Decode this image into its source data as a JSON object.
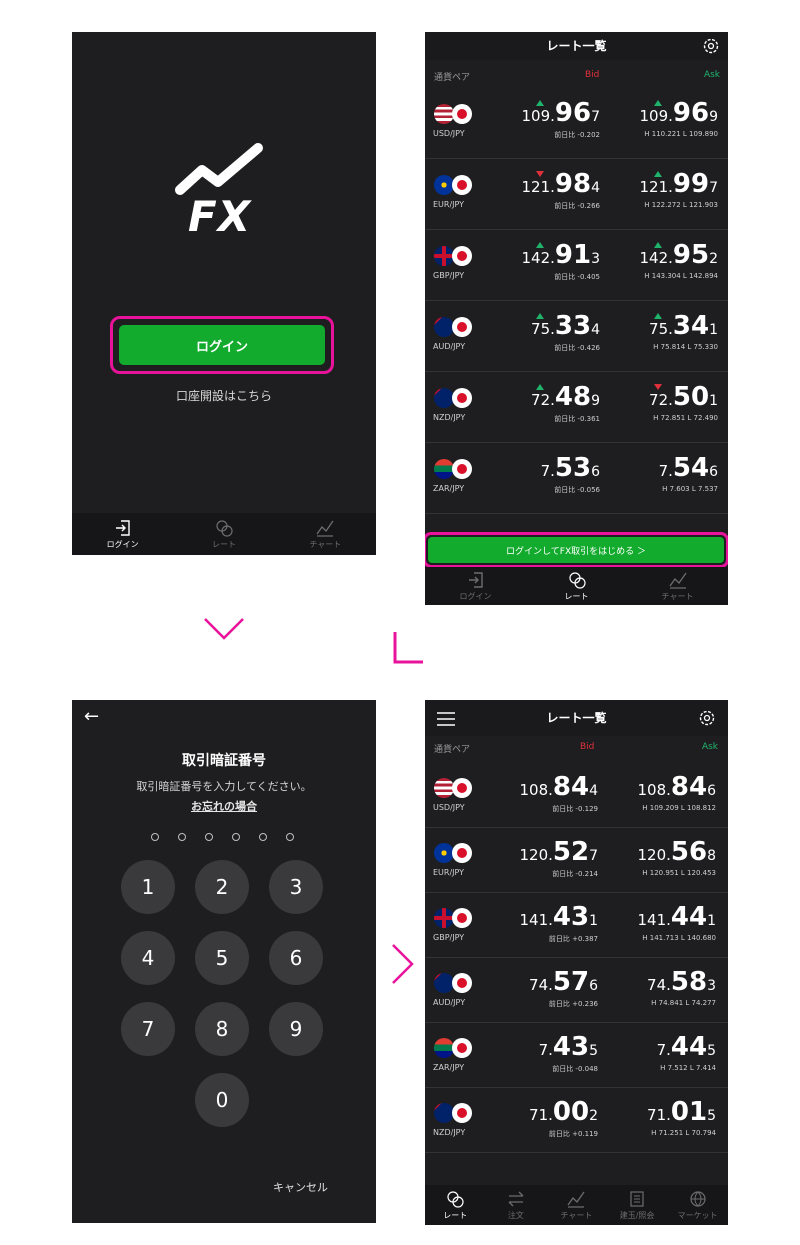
{
  "login": {
    "logo_text": "FX",
    "login_button": "ログイン",
    "open_account": "口座開設はこちら",
    "tabs": [
      {
        "label": "ログイン",
        "icon": "login-icon",
        "active": true
      },
      {
        "label": "レート",
        "icon": "rate-icon",
        "active": false
      },
      {
        "label": "チャート",
        "icon": "chart-icon",
        "active": false
      }
    ]
  },
  "rates1": {
    "title": "レート一覧",
    "col_pair": "通貨ペア",
    "col_bid": "Bid",
    "col_ask": "Ask",
    "rows": [
      {
        "pair": "USD/JPY",
        "bid": {
          "a": "109.",
          "b": "96",
          "c": "7",
          "dir": "up"
        },
        "ask": {
          "a": "109.",
          "b": "96",
          "c": "9",
          "dir": "up"
        },
        "change": "前日比 -0.202",
        "hl": "H 110.221   L 109.890"
      },
      {
        "pair": "EUR/JPY",
        "bid": {
          "a": "121.",
          "b": "98",
          "c": "4",
          "dir": "dn"
        },
        "ask": {
          "a": "121.",
          "b": "99",
          "c": "7",
          "dir": "up"
        },
        "change": "前日比 -0.266",
        "hl": "H 122.272   L 121.903"
      },
      {
        "pair": "GBP/JPY",
        "bid": {
          "a": "142.",
          "b": "91",
          "c": "3",
          "dir": "up"
        },
        "ask": {
          "a": "142.",
          "b": "95",
          "c": "2",
          "dir": "up"
        },
        "change": "前日比 -0.405",
        "hl": "H 143.304   L 142.894"
      },
      {
        "pair": "AUD/JPY",
        "bid": {
          "a": "75.",
          "b": "33",
          "c": "4",
          "dir": "up"
        },
        "ask": {
          "a": "75.",
          "b": "34",
          "c": "1",
          "dir": "up"
        },
        "change": "前日比 -0.426",
        "hl": "H 75.814   L 75.330"
      },
      {
        "pair": "NZD/JPY",
        "bid": {
          "a": "72.",
          "b": "48",
          "c": "9",
          "dir": "up"
        },
        "ask": {
          "a": "72.",
          "b": "50",
          "c": "1",
          "dir": "dn"
        },
        "change": "前日比 -0.361",
        "hl": "H 72.851   L 72.490"
      },
      {
        "pair": "ZAR/JPY",
        "bid": {
          "a": "7.",
          "b": "53",
          "c": "6",
          "dir": "none"
        },
        "ask": {
          "a": "7.",
          "b": "54",
          "c": "6",
          "dir": "none"
        },
        "change": "前日比 -0.056",
        "hl": "H 7.603   L 7.537"
      }
    ],
    "cta": "ログインしてFX取引をはじめる ＞",
    "tabs": [
      {
        "label": "ログイン",
        "icon": "login-icon",
        "active": false
      },
      {
        "label": "レート",
        "icon": "rate-icon",
        "active": true
      },
      {
        "label": "チャート",
        "icon": "chart-icon",
        "active": false
      }
    ]
  },
  "pin": {
    "back": "←",
    "title": "取引暗証番号",
    "description": "取引暗証番号を入力してください。",
    "forgot": "お忘れの場合",
    "keys": [
      "1",
      "2",
      "3",
      "4",
      "5",
      "6",
      "7",
      "8",
      "9",
      "0"
    ],
    "cancel": "キャンセル"
  },
  "rates2": {
    "title": "レート一覧",
    "col_pair": "通貨ペア",
    "col_bid": "Bid",
    "col_ask": "Ask",
    "rows": [
      {
        "pair": "USD/JPY",
        "bid": {
          "a": "108.",
          "b": "84",
          "c": "4"
        },
        "ask": {
          "a": "108.",
          "b": "84",
          "c": "6"
        },
        "change": "前日比 -0.129",
        "hl": "H 109.209   L 108.812"
      },
      {
        "pair": "EUR/JPY",
        "bid": {
          "a": "120.",
          "b": "52",
          "c": "7"
        },
        "ask": {
          "a": "120.",
          "b": "56",
          "c": "8"
        },
        "change": "前日比 -0.214",
        "hl": "H 120.951   L 120.453"
      },
      {
        "pair": "GBP/JPY",
        "bid": {
          "a": "141.",
          "b": "43",
          "c": "1"
        },
        "ask": {
          "a": "141.",
          "b": "44",
          "c": "1"
        },
        "change": "前日比 +0.387",
        "hl": "H 141.713   L 140.680"
      },
      {
        "pair": "AUD/JPY",
        "bid": {
          "a": "74.",
          "b": "57",
          "c": "6"
        },
        "ask": {
          "a": "74.",
          "b": "58",
          "c": "3"
        },
        "change": "前日比 +0.236",
        "hl": "H 74.841   L 74.277"
      },
      {
        "pair": "ZAR/JPY",
        "bid": {
          "a": "7.",
          "b": "43",
          "c": "5"
        },
        "ask": {
          "a": "7.",
          "b": "44",
          "c": "5"
        },
        "change": "前日比 -0.048",
        "hl": "H 7.512   L 7.414"
      },
      {
        "pair": "NZD/JPY",
        "bid": {
          "a": "71.",
          "b": "00",
          "c": "2"
        },
        "ask": {
          "a": "71.",
          "b": "01",
          "c": "5"
        },
        "change": "前日比 +0.119",
        "hl": "H 71.251   L 70.794"
      }
    ],
    "tabs": [
      {
        "label": "レート",
        "icon": "rate-icon",
        "active": true
      },
      {
        "label": "注文",
        "icon": "order-icon",
        "active": false
      },
      {
        "label": "チャート",
        "icon": "chart-icon",
        "active": false
      },
      {
        "label": "建玉/照会",
        "icon": "position-icon",
        "active": false
      },
      {
        "label": "マーケット",
        "icon": "globe-icon",
        "active": false
      }
    ]
  },
  "colors": {
    "accent_green": "#12ab2e",
    "highlight_pink": "#e8139b",
    "bid_red": "#e0303a",
    "ask_green": "#1fb36b"
  }
}
